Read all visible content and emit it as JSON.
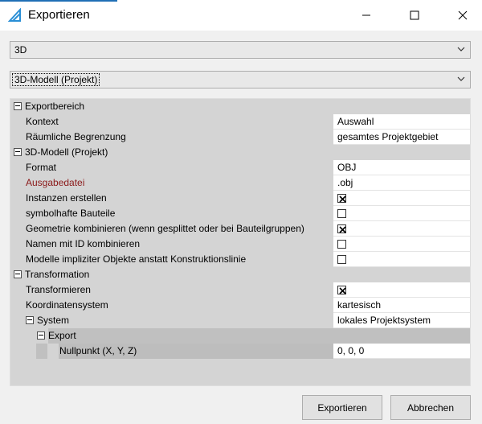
{
  "window": {
    "title": "Exportieren"
  },
  "format_combo": {
    "selected": "3D"
  },
  "model_combo": {
    "selected": "3D-Modell (Projekt)"
  },
  "grid": {
    "exportbereich": {
      "label": "Exportbereich",
      "kontext": {
        "label": "Kontext",
        "value": "Auswahl"
      },
      "begrenzung": {
        "label": "Räumliche Begrenzung",
        "value": "gesamtes Projektgebiet"
      }
    },
    "modell": {
      "label": "3D-Modell (Projekt)",
      "format": {
        "label": "Format",
        "value": "OBJ"
      },
      "ausgabedatei": {
        "label": "Ausgabedatei",
        "value": ".obj"
      },
      "instanzen": {
        "label": "Instanzen erstellen",
        "checked": true
      },
      "symbolhaft": {
        "label": "symbolhafte Bauteile",
        "checked": false
      },
      "geometrie": {
        "label": "Geometrie kombinieren (wenn gesplittet oder bei Bauteilgruppen)",
        "checked": true
      },
      "namen": {
        "label": "Namen mit ID kombinieren",
        "checked": false
      },
      "modelle": {
        "label": "Modelle impliziter Objekte anstatt Konstruktionslinie",
        "checked": false
      }
    },
    "transformation": {
      "label": "Transformation",
      "transformieren": {
        "label": "Transformieren",
        "checked": true
      },
      "koordinatensystem": {
        "label": "Koordinatensystem",
        "value": "kartesisch"
      },
      "system": {
        "label": "System",
        "value": "lokales Projektsystem"
      },
      "export": {
        "label": "Export",
        "nullpunkt": {
          "label": "Nullpunkt (X, Y, Z)",
          "value": "0, 0, 0"
        }
      }
    }
  },
  "buttons": {
    "export": "Exportieren",
    "cancel": "Abbrechen"
  },
  "colors": {
    "accent": "#1f6fb5",
    "required_label": "#8b1a1a"
  }
}
